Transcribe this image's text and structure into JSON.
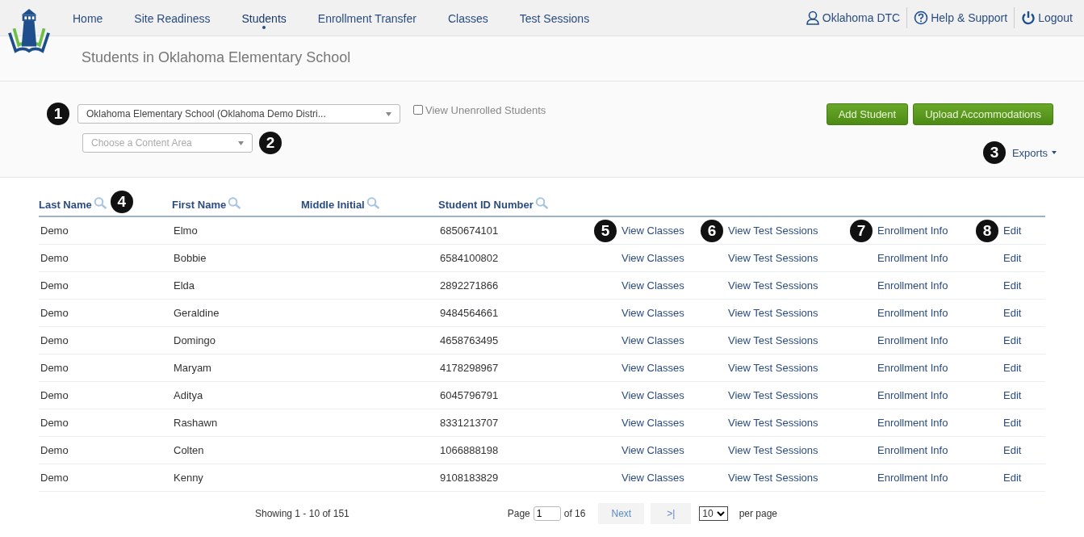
{
  "nav": {
    "items": [
      {
        "label": "Home",
        "selected": false
      },
      {
        "label": "Site Readiness",
        "selected": false
      },
      {
        "label": "Students",
        "selected": true
      },
      {
        "label": "Enrollment Transfer",
        "selected": false
      },
      {
        "label": "Classes",
        "selected": false
      },
      {
        "label": "Test Sessions",
        "selected": false
      }
    ],
    "user": "Oklahoma DTC",
    "help": "Help & Support",
    "logout": "Logout"
  },
  "page_title": "Students in Oklahoma Elementary School",
  "filters": {
    "school_select": {
      "value": "Oklahoma Elementary School (Oklahoma Demo Distri...",
      "callout": "1"
    },
    "unenrolled": {
      "label": "View Unenrolled Students",
      "checked": false
    },
    "content_select": {
      "placeholder": "Choose a Content Area",
      "callout": "2"
    }
  },
  "buttons": [
    "Add Student",
    "Upload Accommodations"
  ],
  "exports": {
    "label": "Exports",
    "callout": "3"
  },
  "table": {
    "columns": [
      {
        "label": "Last Name",
        "callout": "4"
      },
      {
        "label": "First Name"
      },
      {
        "label": "Middle Initial"
      },
      {
        "label": "Student ID Number"
      }
    ],
    "rows": [
      {
        "last": "Demo",
        "first": "Elmo",
        "id": "6850674101",
        "actions": [
          "View Classes",
          "View Test Sessions",
          "Enrollment Info",
          "Edit"
        ],
        "callouts": [
          "5",
          "6",
          "7",
          "8"
        ]
      },
      {
        "last": "Demo",
        "first": "Bobbie",
        "id": "6584100802",
        "actions": [
          "View Classes",
          "View Test Sessions",
          "Enrollment Info",
          "Edit"
        ]
      },
      {
        "last": "Demo",
        "first": "Elda",
        "id": "2892271866",
        "actions": [
          "View Classes",
          "View Test Sessions",
          "Enrollment Info",
          "Edit"
        ]
      },
      {
        "last": "Demo",
        "first": "Geraldine",
        "id": "9484564661",
        "actions": [
          "View Classes",
          "View Test Sessions",
          "Enrollment Info",
          "Edit"
        ]
      },
      {
        "last": "Demo",
        "first": "Domingo",
        "id": "4658763495",
        "actions": [
          "View Classes",
          "View Test Sessions",
          "Enrollment Info",
          "Edit"
        ]
      },
      {
        "last": "Demo",
        "first": "Maryam",
        "id": "4178298967",
        "actions": [
          "View Classes",
          "View Test Sessions",
          "Enrollment Info",
          "Edit"
        ]
      },
      {
        "last": "Demo",
        "first": "Aditya",
        "id": "6045796791",
        "actions": [
          "View Classes",
          "View Test Sessions",
          "Enrollment Info",
          "Edit"
        ]
      },
      {
        "last": "Demo",
        "first": "Rashawn",
        "id": "8331213707",
        "actions": [
          "View Classes",
          "View Test Sessions",
          "Enrollment Info",
          "Edit"
        ]
      },
      {
        "last": "Demo",
        "first": "Colten",
        "id": "1066888198",
        "actions": [
          "View Classes",
          "View Test Sessions",
          "Enrollment Info",
          "Edit"
        ]
      },
      {
        "last": "Demo",
        "first": "Kenny",
        "id": "9108183829",
        "actions": [
          "View Classes",
          "View Test Sessions",
          "Enrollment Info",
          "Edit"
        ]
      }
    ]
  },
  "pagination": {
    "showing": "Showing 1 - 10 of 151",
    "page_label": "Page",
    "page": "1",
    "of": "of 16",
    "next": "Next",
    "last": ">|",
    "per_page_value": "10",
    "per_page_label": "per page"
  }
}
